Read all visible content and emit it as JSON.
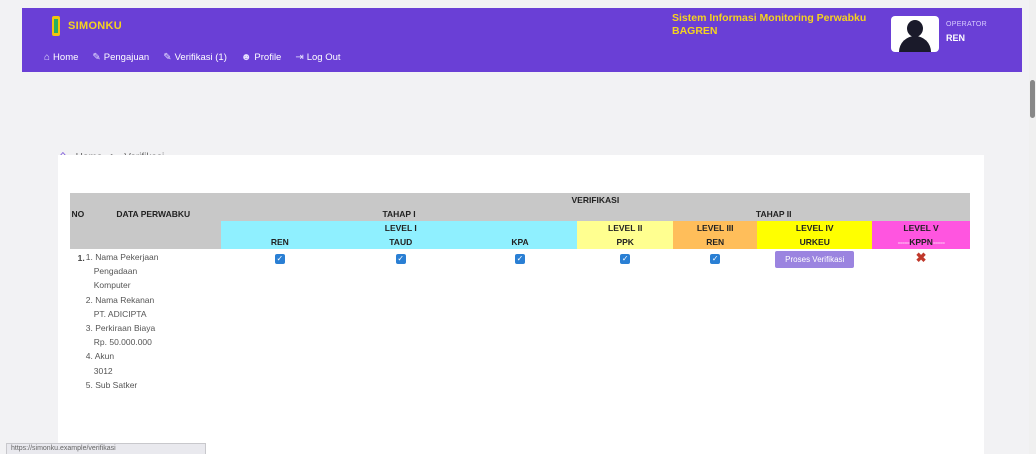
{
  "header": {
    "brand": "SIMONKU",
    "system_title_line1": "Sistem Informasi Monitoring Perwabku",
    "system_title_line2": "BAGREN",
    "role": "OPERATOR",
    "user": "REN"
  },
  "nav": [
    {
      "label": "Home",
      "icon": "home-icon"
    },
    {
      "label": "Pengajuan",
      "icon": "pengajuan-icon"
    },
    {
      "label": "Verifikasi (1)",
      "icon": "verifikasi-icon"
    },
    {
      "label": "Profile",
      "icon": "profile-icon"
    },
    {
      "label": "Log Out",
      "icon": "logout-icon"
    }
  ],
  "breadcrumb": {
    "home": "Home",
    "separator": ">",
    "current": "Verifikasi"
  },
  "table": {
    "col_no": "NO",
    "col_data": "DATA PERWABKU",
    "verifikasi": "VERIFIKASI",
    "tahap1": "TAHAP I",
    "tahap2": "TAHAP II",
    "level1": "LEVEL I",
    "level2": "LEVEL II",
    "level3": "LEVEL III",
    "level4": "LEVEL IV",
    "level5": "LEVEL V",
    "ren": "REN",
    "taud": "TAUD",
    "kpa": "KPA",
    "ppk": "PPK",
    "ren2": "REN",
    "urkeu": "URKEU",
    "kppn": "KPPN",
    "kppn_dots": "-----",
    "row1": {
      "no": "1.",
      "data": [
        "1. Nama Pekerjaan",
        "Pengadaan",
        "Komputer",
        "2. Nama Rekanan",
        "PT. ADICIPTA",
        "3. Perkiraan Biaya",
        "Rp. 50.000.000",
        "4. Akun",
        "3012",
        "5. Sub Satker"
      ],
      "button": "Proses Verifikasi"
    }
  },
  "status_bar": "https://simonku.example/verifikasi"
}
